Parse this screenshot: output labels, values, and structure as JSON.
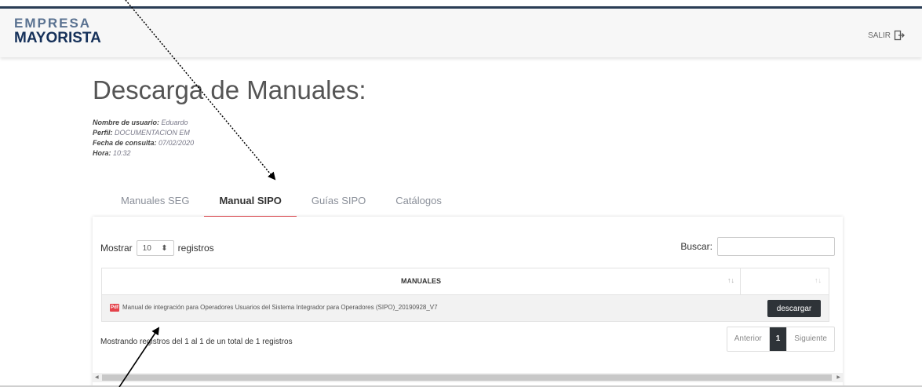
{
  "header": {
    "logo_top": "EMPRESA",
    "logo_bottom": "MAYORISTA",
    "salir_label": "SALIR",
    "salir_icon": "logout-icon"
  },
  "page": {
    "title": "Descarga de Manuales:",
    "meta": {
      "user_label": "Nombre de usuario:",
      "user_value": " Eduardo",
      "profile_label": "Perfil:",
      "profile_value": " DOCUMENTACION EM",
      "date_label": "Fecha de consulta:",
      "date_value": " 07/02/2020",
      "time_label": "Hora:",
      "time_value": " 10:32"
    }
  },
  "tabs": [
    {
      "label": "Manuales SEG",
      "active": false
    },
    {
      "label": "Manual SIPO",
      "active": true
    },
    {
      "label": "Guías SIPO",
      "active": false
    },
    {
      "label": "Catálogos",
      "active": false
    }
  ],
  "table": {
    "show_label": "Mostrar",
    "show_value": "10",
    "records_label": "registros",
    "search_label": "Buscar:",
    "search_value": "",
    "column_header": "MANUALES",
    "rows": [
      {
        "icon": "pdf-icon",
        "icon_text": "Pdf",
        "title": "Manual de integración para Operadores Usuarios del Sistema Integrador para Operadores (SIPO)_20190928_V7",
        "action": "descargar"
      }
    ],
    "info": "Mostrando registros del 1 al 1 de un total de 1 registros",
    "pagination": {
      "prev": "Anterior",
      "current": "1",
      "next": "Siguiente"
    }
  },
  "colors": {
    "accent": "#e4434b",
    "header_border": "#2a3d55",
    "dark_button": "#2e3338"
  }
}
